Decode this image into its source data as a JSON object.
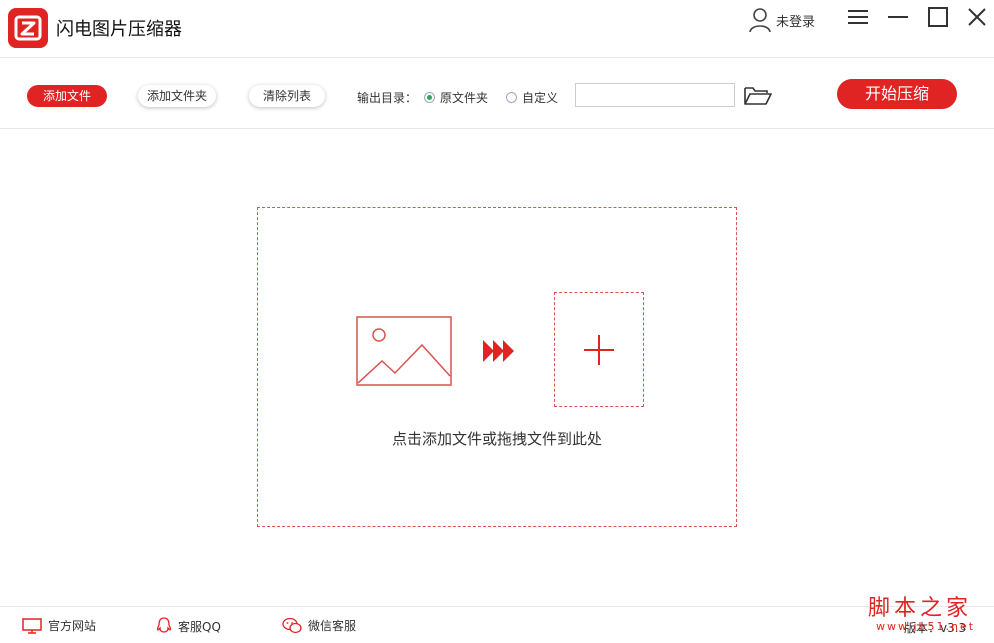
{
  "app": {
    "title": "闪电图片压缩器",
    "logo_icon": "lightning-z-logo",
    "accent_color": "#e02424"
  },
  "header": {
    "login_label": "未登录"
  },
  "toolbar": {
    "add_file_label": "添加文件",
    "add_folder_label": "添加文件夹",
    "clear_list_label": "清除列表",
    "output_dir_label": "输出目录：",
    "output_options": [
      {
        "label": "原文件夹",
        "selected": true
      },
      {
        "label": "自定义",
        "selected": false
      }
    ],
    "path_value": "",
    "start_label": "开始压缩"
  },
  "dropzone": {
    "hint": "点击添加文件或拖拽文件到此处"
  },
  "footer": {
    "items": [
      {
        "label": "官方网站",
        "icon": "monitor-icon"
      },
      {
        "label": "客服QQ",
        "icon": "qq-icon"
      },
      {
        "label": "微信客服",
        "icon": "wechat-icon"
      }
    ],
    "version": "版本：v3.3"
  },
  "watermark": {
    "text": "脚本之家",
    "sub": "www.jb51.net"
  }
}
